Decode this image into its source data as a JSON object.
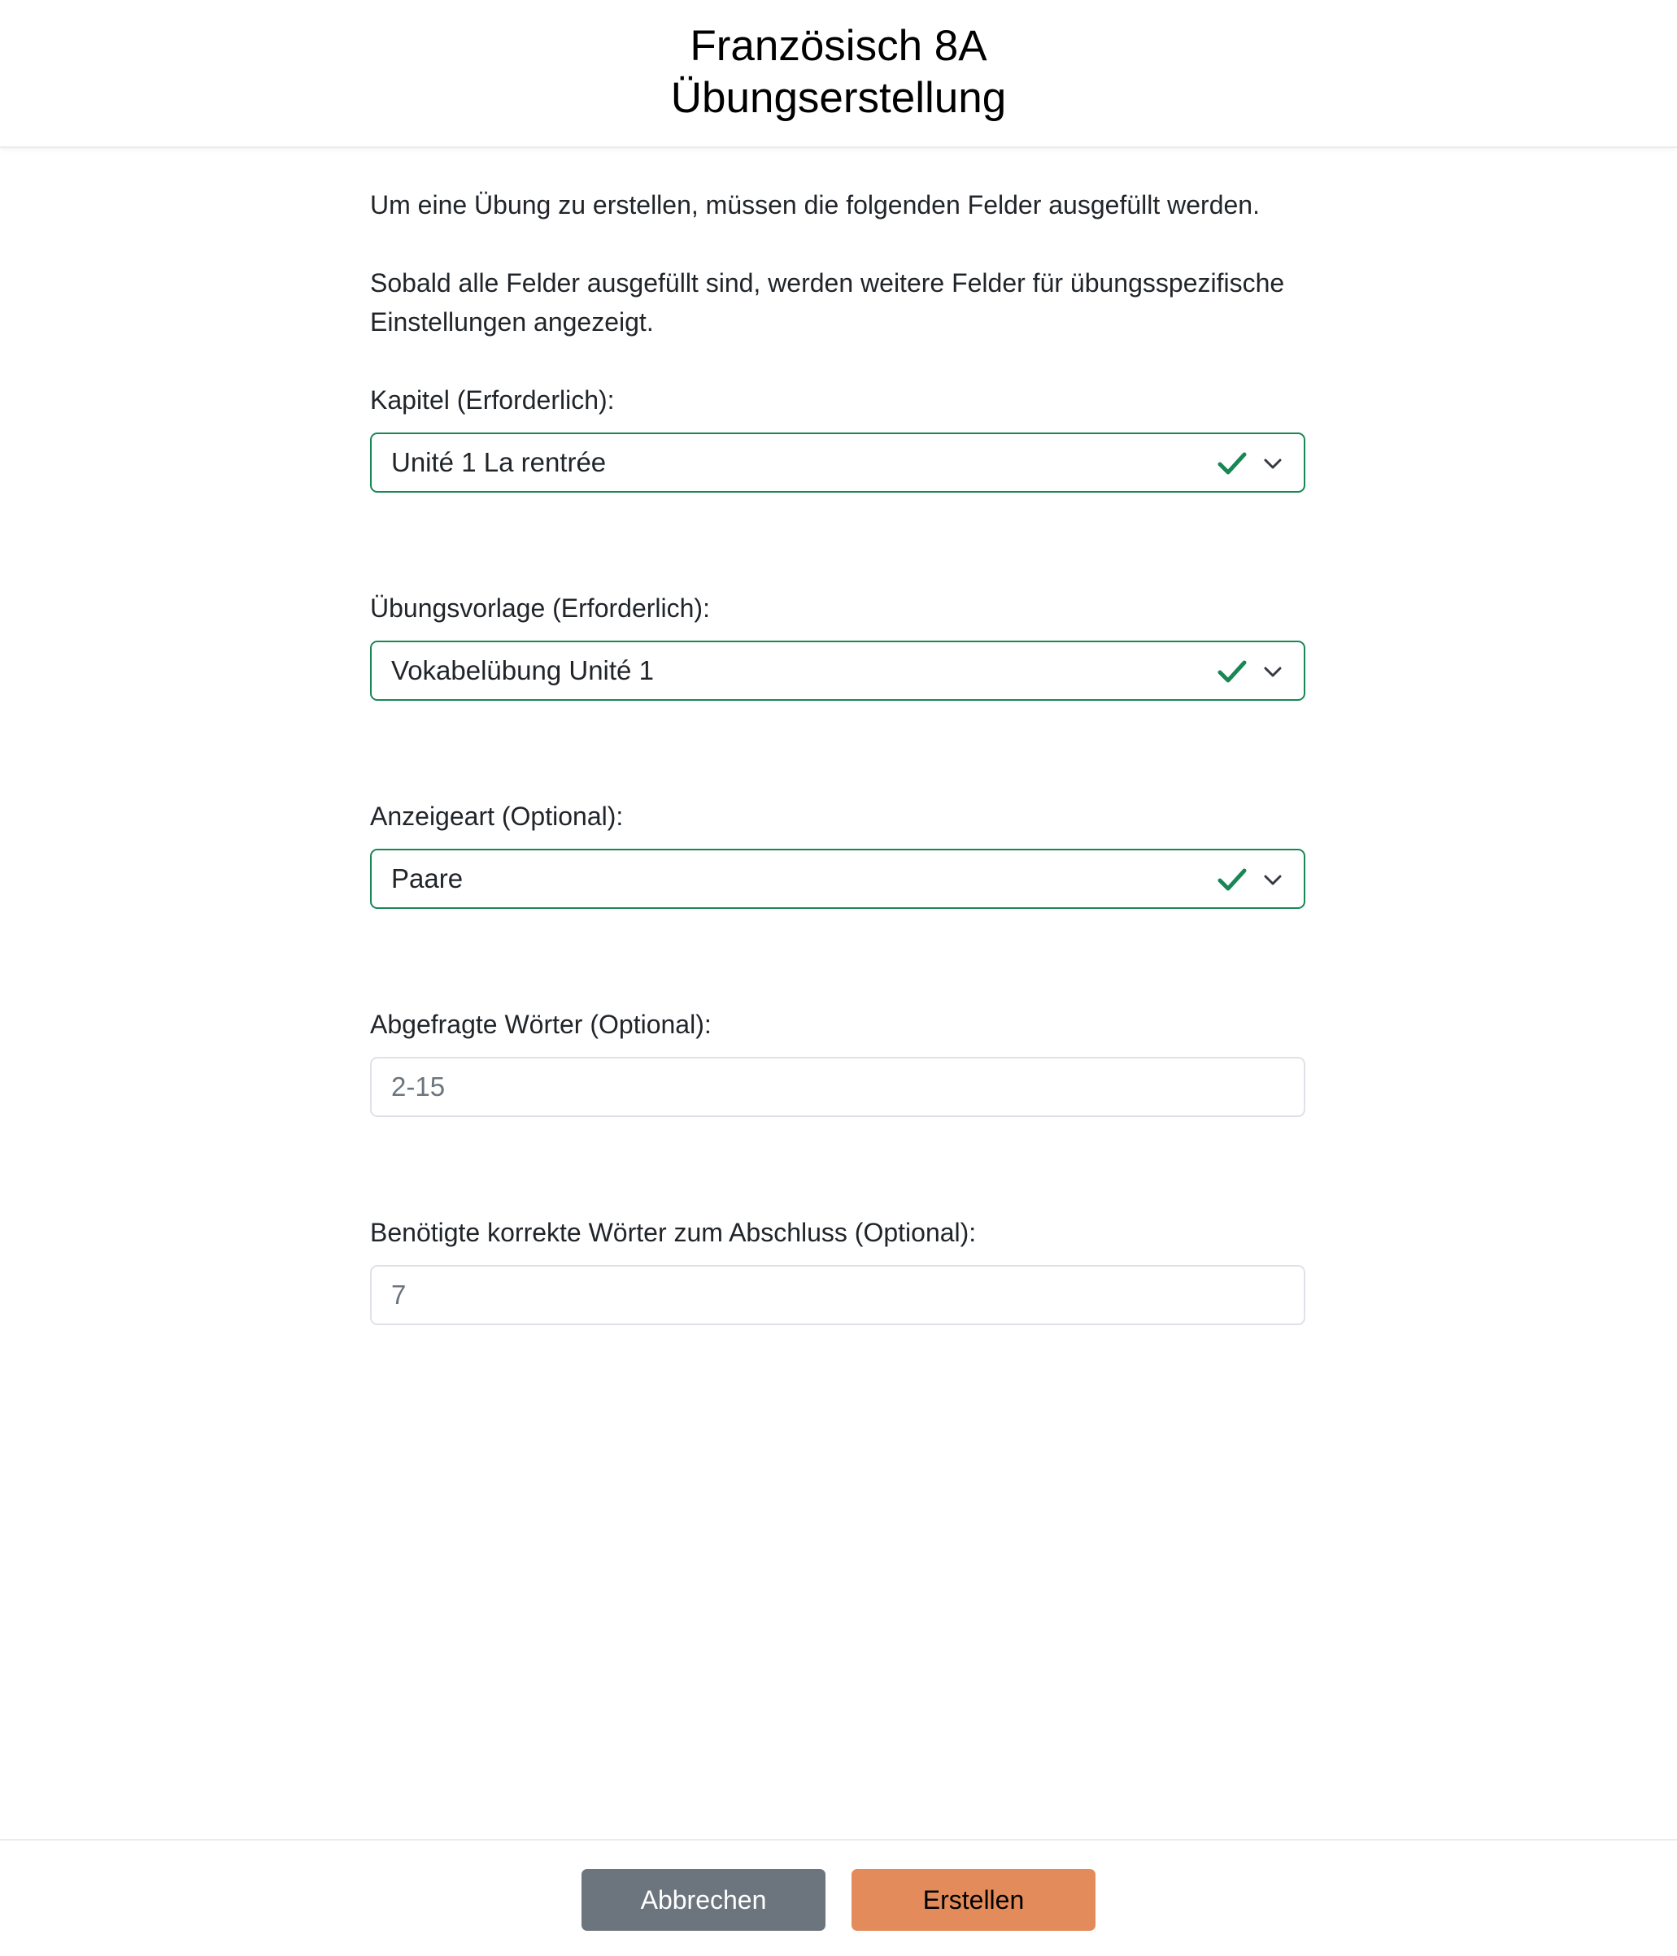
{
  "header": {
    "title_line1": "Französisch 8A",
    "title_line2": "Übungserstellung"
  },
  "intro": {
    "line1": "Um eine Übung zu erstellen, müssen die folgenden Felder ausgefüllt werden.",
    "line2": "Sobald alle Felder ausgefüllt sind, werden weitere Felder für übungsspezifische Einstellungen angezeigt."
  },
  "fields": {
    "kapitel": {
      "label": "Kapitel (Erforderlich):",
      "value": "Unité 1 La rentrée",
      "icon_valid": "check-icon",
      "icon_dropdown": "chevron-down-icon"
    },
    "vorlage": {
      "label": "Übungsvorlage (Erforderlich):",
      "value": "Vokabelübung Unité 1",
      "icon_valid": "check-icon",
      "icon_dropdown": "chevron-down-icon"
    },
    "anzeigeart": {
      "label": "Anzeigeart (Optional):",
      "value": "Paare",
      "icon_valid": "check-icon",
      "icon_dropdown": "chevron-down-icon"
    },
    "woerter": {
      "label": "Abgefragte Wörter (Optional):",
      "placeholder": "2-15"
    },
    "korrekt": {
      "label": "Benötigte korrekte Wörter zum Abschluss (Optional):",
      "placeholder": "7"
    }
  },
  "footer": {
    "cancel_label": "Abbrechen",
    "create_label": "Erstellen"
  },
  "colors": {
    "valid_border": "#198754",
    "cancel_button": "#6c757d",
    "create_button": "#e38b5a"
  }
}
